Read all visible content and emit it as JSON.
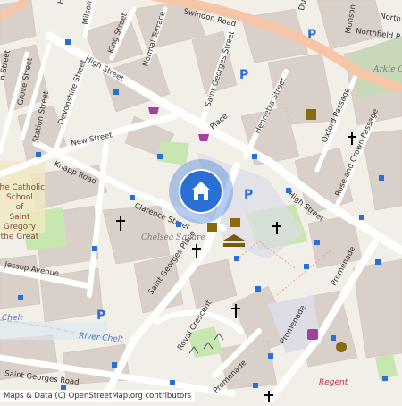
{
  "map": {
    "streets": [
      {
        "id": "swindon-road",
        "text": "Swindon Road"
      },
      {
        "id": "high-street-nw",
        "text": "High Street"
      },
      {
        "id": "high-street-se",
        "text": "High Street"
      },
      {
        "id": "new-street",
        "text": "New Street"
      },
      {
        "id": "knapp-road",
        "text": "Knapp Road"
      },
      {
        "id": "clarence-street",
        "text": "Clarence Street"
      },
      {
        "id": "jessop-avenue",
        "text": "Jessop Avenue"
      },
      {
        "id": "st-georges-place",
        "text": "Saint Georges Place"
      },
      {
        "id": "st-georges-street",
        "text": "Saint Georges Street"
      },
      {
        "id": "st-georges-road",
        "text": "Saint Georges Road"
      },
      {
        "id": "henrietta-street",
        "text": "Henrietta Street"
      },
      {
        "id": "oxford-passage",
        "text": "Oxford Passage"
      },
      {
        "id": "rose-crown-passage",
        "text": "Rose and Crown Passage"
      },
      {
        "id": "promenade-1",
        "text": "Promenade"
      },
      {
        "id": "promenade-2",
        "text": "Promenade"
      },
      {
        "id": "promenade-3",
        "text": "Promenade"
      },
      {
        "id": "royal-crescent",
        "text": "Royal Crescent"
      },
      {
        "id": "devonshire-street",
        "text": "Devonshire Street"
      },
      {
        "id": "station-street",
        "text": "Station Street"
      },
      {
        "id": "grove-street",
        "text": "Grove Street"
      },
      {
        "id": "milsom-street",
        "text": "Milsom Street"
      },
      {
        "id": "king-street",
        "text": "King Street"
      },
      {
        "id": "normal-terrace",
        "text": "Normal Terrace"
      },
      {
        "id": "northfield-p",
        "text": "Northfield P"
      },
      {
        "id": "monson",
        "text": "Monson"
      },
      {
        "id": "dun",
        "text": "Dun"
      },
      {
        "id": "he",
        "text": "He"
      },
      {
        "id": "cut-street",
        "text": "n Street"
      },
      {
        "id": "north",
        "text": "North"
      },
      {
        "id": "cut-place",
        "text": "Place"
      }
    ],
    "places": [
      {
        "id": "chelsea-square",
        "text": "Chelsea Square"
      },
      {
        "id": "arkle",
        "text": "Arkle Co"
      },
      {
        "id": "school",
        "lines": [
          "The Catholic",
          "School",
          "of",
          "Saint",
          "Gregory",
          "the Great"
        ]
      },
      {
        "id": "river",
        "text": "River Chelt"
      },
      {
        "id": "regent",
        "text": "Regent"
      },
      {
        "id": "chelt-w",
        "text": "Chelt"
      }
    ],
    "location_marker": {
      "icon": "home-icon",
      "accent": "#2a6fd6"
    },
    "colors": {
      "road_major": "#f7c6a8",
      "road_pedestrian": "#dddde8",
      "park": "#c8e6b0",
      "water": "#aad3df",
      "building": "#d9d0c9",
      "land": "#f2efe9",
      "marker": "#2a6fd6"
    }
  },
  "attribution": "Maps & Data (C) OpenStreetMap.org contributors"
}
